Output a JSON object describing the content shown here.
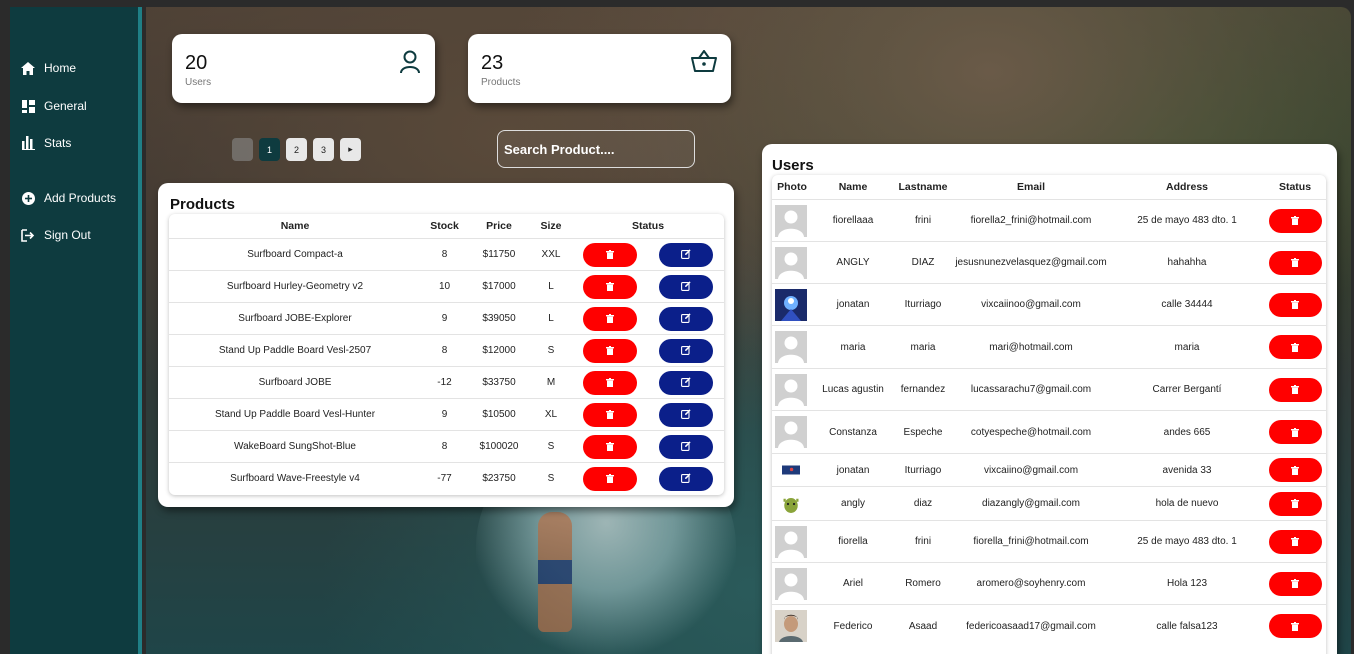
{
  "sidebar": {
    "items": [
      {
        "label": "Home",
        "icon": "home-icon"
      },
      {
        "label": "General",
        "icon": "grid-icon"
      },
      {
        "label": "Stats",
        "icon": "bar-chart-icon"
      },
      {
        "label": "Add Products",
        "icon": "plus-circle-icon"
      },
      {
        "label": "Sign Out",
        "icon": "sign-out-icon"
      }
    ]
  },
  "stats": {
    "users": {
      "value": "20",
      "label": "Users",
      "icon": "user-icon"
    },
    "products": {
      "value": "23",
      "label": "Products",
      "icon": "basket-icon"
    }
  },
  "pagination": {
    "prev": "",
    "pages": [
      "1",
      "2",
      "3"
    ],
    "next": "▸",
    "current": "1"
  },
  "search": {
    "placeholder": "Search Product...."
  },
  "products": {
    "title": "Products",
    "headers": {
      "name": "Name",
      "stock": "Stock",
      "price": "Price",
      "size": "Size",
      "status": "Status"
    },
    "rows": [
      {
        "name": "Surfboard Compact-a",
        "stock": "8",
        "price": "$11750",
        "size": "XXL"
      },
      {
        "name": "Surfboard Hurley-Geometry v2",
        "stock": "10",
        "price": "$17000",
        "size": "L"
      },
      {
        "name": "Surfboard JOBE-Explorer",
        "stock": "9",
        "price": "$39050",
        "size": "L"
      },
      {
        "name": "Stand Up Paddle Board Vesl-2507",
        "stock": "8",
        "price": "$12000",
        "size": "S"
      },
      {
        "name": "Surfboard JOBE",
        "stock": "-12",
        "price": "$33750",
        "size": "M"
      },
      {
        "name": "Stand Up Paddle Board Vesl-Hunter",
        "stock": "9",
        "price": "$10500",
        "size": "XL"
      },
      {
        "name": "WakeBoard SungShot-Blue",
        "stock": "8",
        "price": "$100020",
        "size": "S"
      },
      {
        "name": "Surfboard Wave-Freestyle v4",
        "stock": "-77",
        "price": "$23750",
        "size": "S"
      }
    ]
  },
  "users": {
    "title": "Users",
    "headers": {
      "photo": "Photo",
      "name": "Name",
      "lastname": "Lastname",
      "email": "Email",
      "address": "Address",
      "status": "Status"
    },
    "rows": [
      {
        "photo": "default",
        "name": "fiorellaaa",
        "lastname": "frini",
        "email": "fiorella2_frini@hotmail.com",
        "address": "25 de mayo 483 dto. 1"
      },
      {
        "photo": "default",
        "name": "ANGLY",
        "lastname": "DIAZ",
        "email": "jesusnunezvelasquez@gmail.com",
        "address": "hahahha"
      },
      {
        "photo": "anime",
        "name": "jonatan",
        "lastname": "Iturriago",
        "email": "vixcaiinoo@gmail.com",
        "address": "calle 34444"
      },
      {
        "photo": "default",
        "name": "maria",
        "lastname": "maria",
        "email": "mari@hotmail.com",
        "address": "maria"
      },
      {
        "photo": "default",
        "name": "Lucas agustin",
        "lastname": "fernandez",
        "email": "lucassarachu7@gmail.com",
        "address": "Carrer Bergantí"
      },
      {
        "photo": "default",
        "name": "Constanza",
        "lastname": "Espeche",
        "email": "cotyespeche@hotmail.com",
        "address": "andes 665"
      },
      {
        "photo": "small-blue",
        "name": "jonatan",
        "lastname": "Iturriago",
        "email": "vixcaiino@gmail.com",
        "address": "avenida 33"
      },
      {
        "photo": "shrek",
        "name": "angly",
        "lastname": "diaz",
        "email": "diazangly@gmail.com",
        "address": "hola de nuevo"
      },
      {
        "photo": "default",
        "name": "fiorella",
        "lastname": "frini",
        "email": "fiorella_frini@hotmail.com",
        "address": "25 de mayo 483 dto. 1"
      },
      {
        "photo": "default",
        "name": "Ariel",
        "lastname": "Romero",
        "email": "aromero@soyhenry.com",
        "address": "Hola 123"
      },
      {
        "photo": "face",
        "name": "Federico",
        "lastname": "Asaad",
        "email": "federicoasaad17@gmail.com",
        "address": "calle falsa123"
      }
    ]
  },
  "colors": {
    "sidebar": "#0e3b3f",
    "delete": "#ff0000",
    "edit": "#0b1f8a",
    "accent": "#1f7f86"
  }
}
